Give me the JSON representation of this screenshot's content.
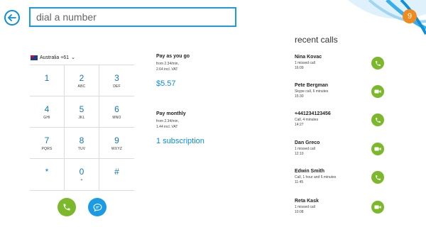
{
  "dialer": {
    "placeholder": "dial a number"
  },
  "notifications": {
    "count": "9"
  },
  "country": {
    "label": "Australia +61"
  },
  "keypad": [
    {
      "digit": "1",
      "letters": ""
    },
    {
      "digit": "2",
      "letters": "ABC"
    },
    {
      "digit": "3",
      "letters": "DEF"
    },
    {
      "digit": "4",
      "letters": "GHI"
    },
    {
      "digit": "5",
      "letters": "JKL"
    },
    {
      "digit": "6",
      "letters": "MNO"
    },
    {
      "digit": "7",
      "letters": "PQRS"
    },
    {
      "digit": "8",
      "letters": "TUV"
    },
    {
      "digit": "9",
      "letters": "WXYZ"
    },
    {
      "digit": "*",
      "letters": ""
    },
    {
      "digit": "0",
      "letters": "+"
    },
    {
      "digit": "#",
      "letters": ""
    }
  ],
  "plans": [
    {
      "title": "Pay as you go",
      "line1": "from 2.34/min,",
      "line2": "2.64 incl. VAT",
      "value": "$5.57"
    },
    {
      "title": "Pay monthly",
      "line1": "from 2.34/min,",
      "line2": "1.44 incl. VAT",
      "value": "1 subscription"
    }
  ],
  "recent": {
    "title": "recent calls",
    "calls": [
      {
        "name": "Nina Kovac",
        "status": "1 missed call",
        "time": "16:09",
        "action": "phone-icon"
      },
      {
        "name": "Pete Bergman",
        "status": "Skype call, 6 minutes",
        "time": "15:30",
        "action": "video-icon"
      },
      {
        "name": "+441234123456",
        "status": "Call, 4 minutes",
        "time": "14:27",
        "action": "phone-icon"
      },
      {
        "name": "Dan Greco",
        "status": "1 missed call",
        "time": "12:10",
        "action": "video-icon"
      },
      {
        "name": "Edwin Smith",
        "status": "Call, 1 hour and 6 minutes",
        "time": "11:45",
        "action": "phone-icon"
      },
      {
        "name": "Reta Kask",
        "status": "1 missed call",
        "time": "10:08",
        "action": "video-icon"
      }
    ]
  },
  "colors": {
    "accent": "#1a9be6",
    "green": "#7bb82a",
    "orange": "#f08a1d"
  }
}
